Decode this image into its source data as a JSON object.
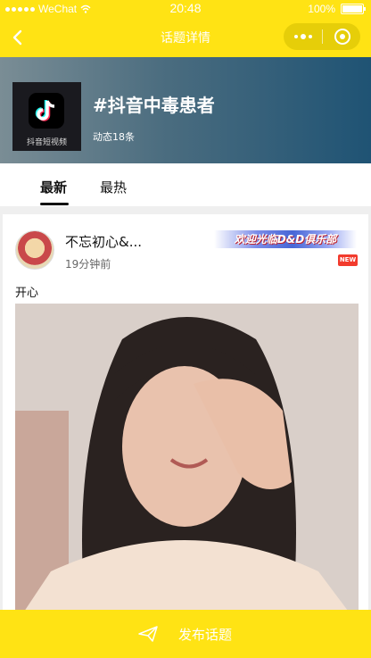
{
  "status_bar": {
    "carrier": "WeChat",
    "time": "20:48",
    "battery": "100%"
  },
  "navbar": {
    "title": "话题详情"
  },
  "topic": {
    "title": "#抖音中毒患者",
    "count": "动态18条",
    "cover_text": "抖音短视频"
  },
  "tabs": [
    {
      "label": "最新"
    },
    {
      "label": "最热"
    }
  ],
  "post": {
    "username": "不忘初心&...",
    "time": "19分钟前",
    "badge": "欢迎光临D&D俱乐部",
    "new_tag": "NEW",
    "content": "开心"
  },
  "bottom": {
    "publish_label": "发布话题"
  },
  "colors": {
    "accent": "#FFE314"
  }
}
